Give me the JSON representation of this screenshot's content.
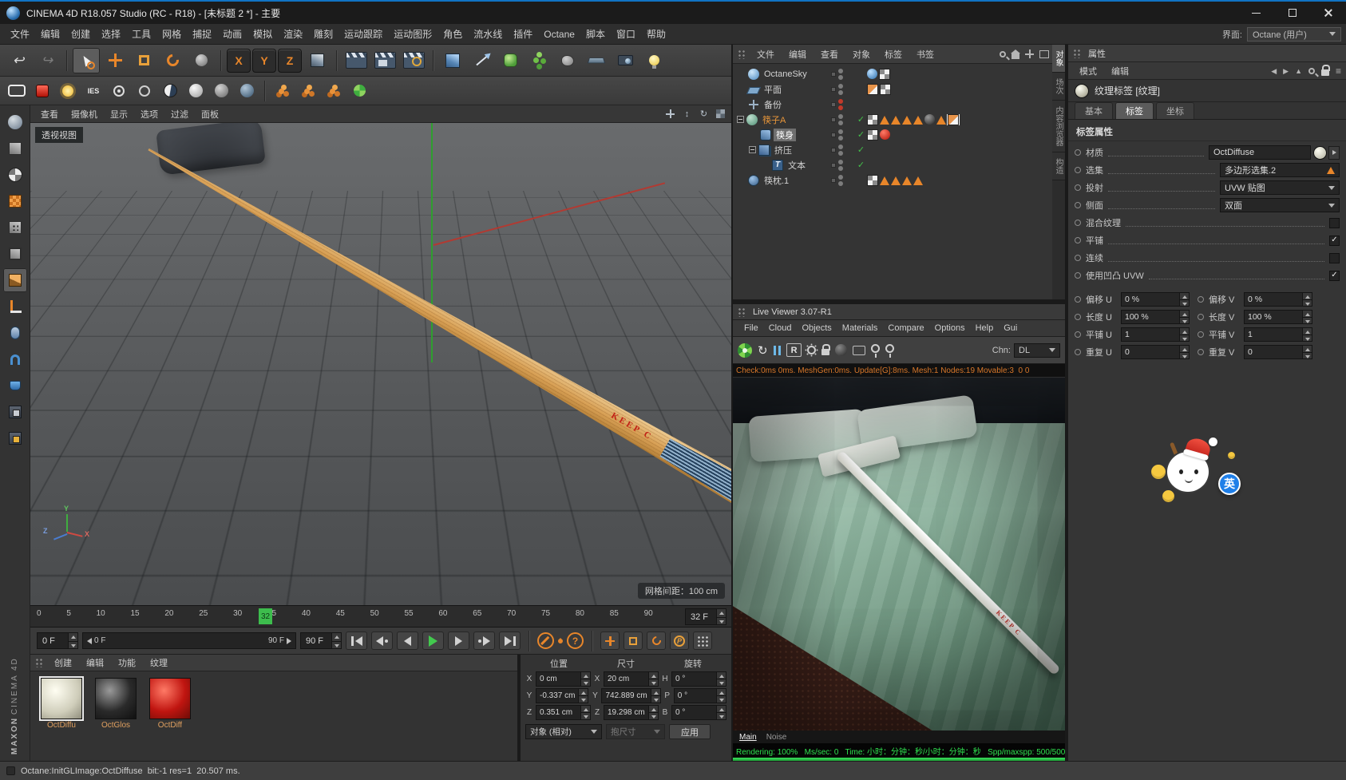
{
  "titlebar": {
    "title": "CINEMA 4D R18.057 Studio (RC - R18) - [未标题 2 *] - 主要"
  },
  "menubar": {
    "items": [
      "文件",
      "编辑",
      "创建",
      "选择",
      "工具",
      "网格",
      "捕捉",
      "动画",
      "模拟",
      "渲染",
      "雕刻",
      "运动跟踪",
      "运动图形",
      "角色",
      "流水线",
      "插件",
      "Octane",
      "脚本",
      "窗口",
      "帮助"
    ],
    "interface_label": "界面:",
    "interface_value": "Octane (用户)"
  },
  "toolbar": {
    "x": "X",
    "y": "Y",
    "z": "Z",
    "ies": "IES"
  },
  "viewport": {
    "menu": [
      "查看",
      "摄像机",
      "显示",
      "选项",
      "过滤",
      "面板"
    ],
    "view_label": "透视视图",
    "grid_spacing": "网格间距：100 cm",
    "axis_x": "X",
    "axis_y": "Y",
    "axis_z": "Z",
    "stick_text": "KEEP C"
  },
  "timeline": {
    "ticks": [
      "0",
      "5",
      "10",
      "15",
      "20",
      "25",
      "30",
      "35",
      "40",
      "45",
      "50",
      "55",
      "60",
      "65",
      "70",
      "75",
      "80",
      "85",
      "90"
    ],
    "current": "32",
    "current_field": "32 F",
    "start_field": "0 F",
    "range_start": "0 F",
    "range_end": "90 F",
    "end_field": "90 F"
  },
  "materials": {
    "menu": [
      "创建",
      "编辑",
      "功能",
      "纹理"
    ],
    "names": [
      "OctDiffu",
      "OctGlos",
      "OctDiff"
    ]
  },
  "coords": {
    "headers": [
      "位置",
      "尺寸",
      "旋转"
    ],
    "labels": {
      "x": "X",
      "y": "Y",
      "z": "Z",
      "h": "H",
      "p": "P",
      "b": "B"
    },
    "pos": {
      "x": "0 cm",
      "y": "-0.337 cm",
      "z": "0.351 cm"
    },
    "size": {
      "x": "20 cm",
      "y": "742.889 cm",
      "z": "19.298 cm"
    },
    "rot": {
      "h": "0 °",
      "p": "0 °",
      "b": "0 °"
    },
    "mode": "对象 (相对)",
    "size_mode": "抱尺寸",
    "apply": "应用"
  },
  "om": {
    "menu": [
      "文件",
      "编辑",
      "查看",
      "对象",
      "标签",
      "书签"
    ],
    "tabs": [
      "对象",
      "场次",
      "内容浏览器",
      "构造"
    ],
    "objects": [
      "OctaneSky",
      "平面",
      "备份",
      "筷子A",
      "筷身",
      "挤压",
      "文本",
      "筷枕.1"
    ]
  },
  "lv": {
    "title": "Live Viewer 3.07-R1",
    "menu": [
      "File",
      "Cloud",
      "Objects",
      "Materials",
      "Compare",
      "Options",
      "Help",
      "Gui"
    ],
    "r_button": "R",
    "chn_label": "Chn:",
    "chn_value": "DL",
    "stats": "Check:0ms 0ms. MeshGen:0ms. Update[G]:8ms. Mesh:1 Nodes:19 Movable:3  0 0",
    "render_text": "KEEP C",
    "tabs": [
      "Main",
      "Noise"
    ],
    "footer": "Rendering: 100%   Ms/sec: 0   Time: 小时：分钟：秒/小时：分钟：秒   Spp/maxspp: 500/500"
  },
  "attr": {
    "title": "属性",
    "mode": "模式",
    "edit": "编辑",
    "tag_title": "纹理标签 [纹理]",
    "tabs": [
      "基本",
      "标签",
      "坐标"
    ],
    "section": "标签属性",
    "rows": {
      "material_label": "材质",
      "material": "OctDiffuse",
      "selection_label": "选集",
      "selection": "多边形选集.2",
      "projection_label": "投射",
      "projection": "UVW 贴图",
      "side_label": "侧面",
      "side": "双面",
      "mix": "混合纹理",
      "tile": "平铺",
      "seamless": "连续",
      "bump": "使用凹凸 UVW"
    },
    "uv": {
      "offu_l": "偏移 U",
      "offu": "0 %",
      "offv_l": "偏移 V",
      "offv": "0 %",
      "lenu_l": "长度 U",
      "lenu": "100 %",
      "lenv_l": "长度 V",
      "lenv": "100 %",
      "tileu_l": "平铺 U",
      "tileu": "1",
      "tilev_l": "平铺 V",
      "tilev": "1",
      "repu_l": "重复 U",
      "repu": "0",
      "repv_l": "重复 V",
      "repv": "0"
    }
  },
  "statusbar": {
    "text": "Octane:InitGLImage:OctDiffuse  bit:-1 res=1  20.507 ms."
  },
  "sticker": {
    "badge": "英"
  },
  "brand": {
    "maxon": "MAXON",
    "c4d": "CINEMA 4D"
  }
}
